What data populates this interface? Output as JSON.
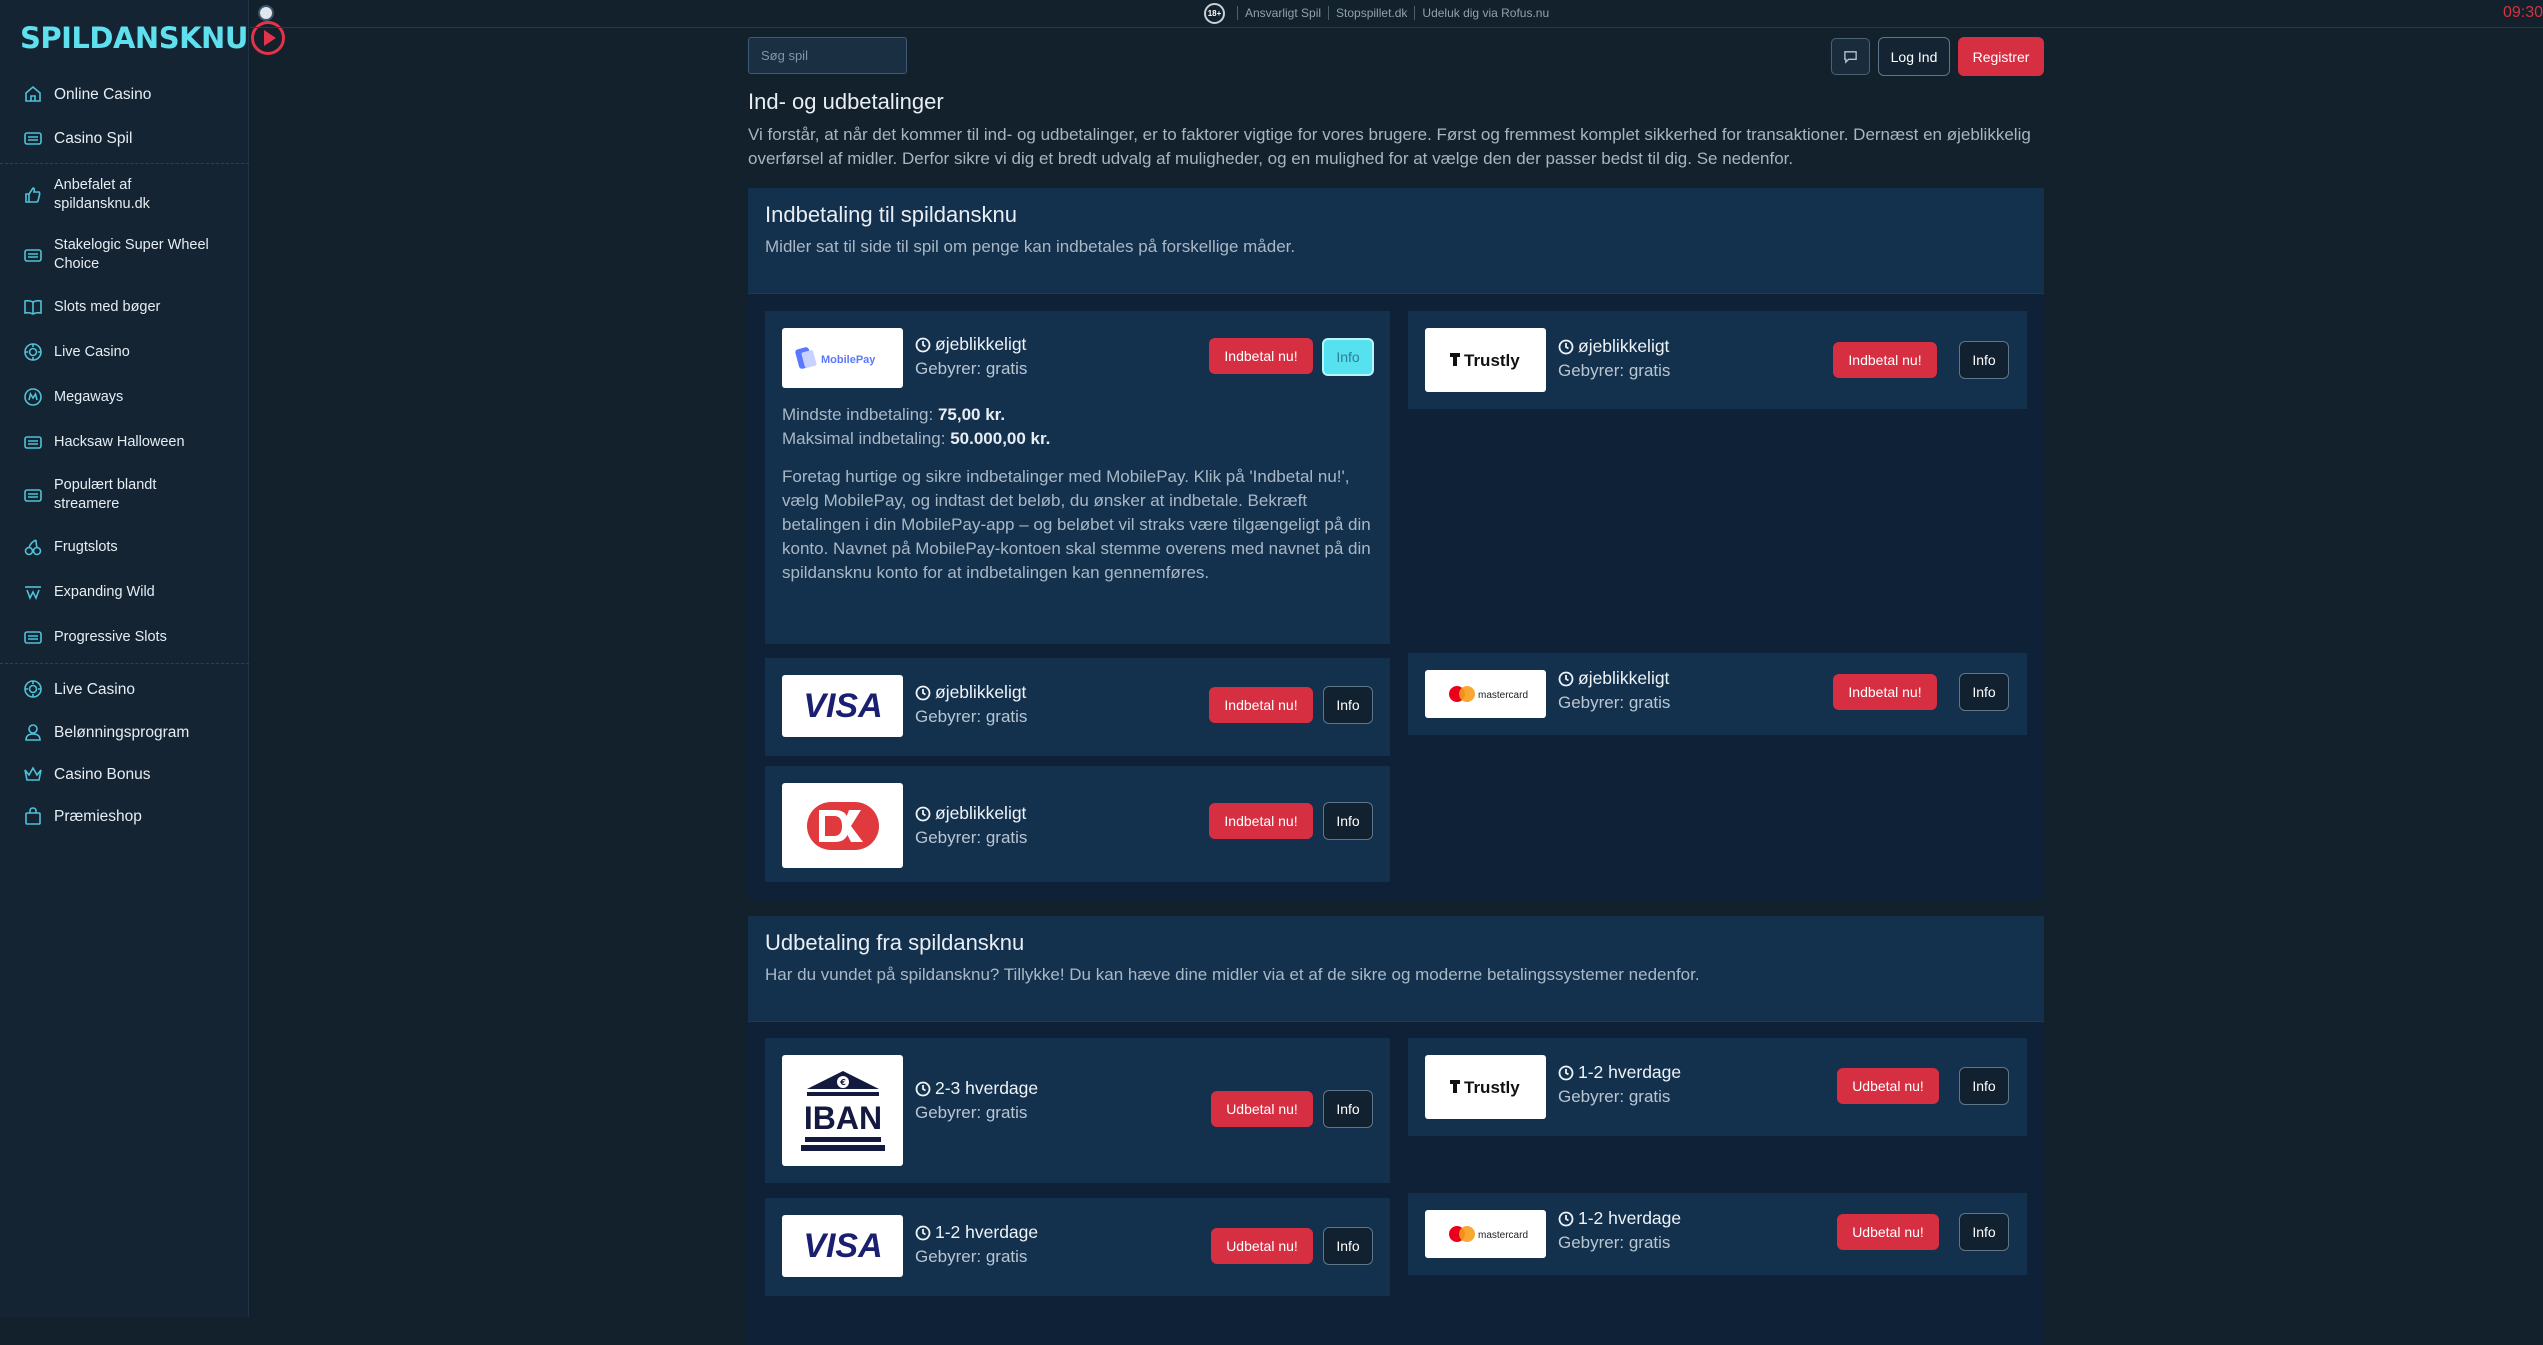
{
  "brand": {
    "name": "SPILDANSKNU"
  },
  "topbar": {
    "age_badge": "18+",
    "links": [
      "Ansvarligt Spil",
      "Stopspillet.dk",
      "Udeluk dig via Rofus.nu"
    ],
    "clock": "09:30"
  },
  "sidebar": {
    "primary": [
      {
        "label": "Online Casino",
        "icon": "home-icon"
      },
      {
        "label": "Casino Spil",
        "icon": "slot-machine-icon"
      }
    ],
    "games": [
      {
        "label": "Anbefalet af spildansknu.dk",
        "icon": "thumbs-up-icon"
      },
      {
        "label": "Stakelogic Super Wheel Choice",
        "icon": "slot-machine-icon"
      },
      {
        "label": "Slots med bøger",
        "icon": "book-icon"
      },
      {
        "label": "Live Casino",
        "icon": "poker-chip-icon"
      },
      {
        "label": "Megaways",
        "icon": "megaways-icon"
      },
      {
        "label": "Hacksaw Halloween",
        "icon": "slot-machine-icon"
      },
      {
        "label": "Populært blandt streamere",
        "icon": "slot-machine-icon"
      },
      {
        "label": "Frugtslots",
        "icon": "cherry-icon"
      },
      {
        "label": "Expanding Wild",
        "icon": "wild-icon"
      },
      {
        "label": "Progressive Slots",
        "icon": "slot-machine-icon"
      }
    ],
    "footer": [
      {
        "label": "Live Casino",
        "icon": "poker-chip-icon"
      },
      {
        "label": "Belønningsprogram",
        "icon": "user-icon"
      },
      {
        "label": "Casino Bonus",
        "icon": "crown-icon"
      },
      {
        "label": "Præmieshop",
        "icon": "shopping-bag-icon"
      }
    ]
  },
  "header": {
    "search_placeholder": "Søg spil",
    "login_label": "Log Ind",
    "register_label": "Registrer"
  },
  "page": {
    "title": "Ind- og udbetalinger",
    "intro": "Vi forstår, at når det kommer til ind- og udbetalinger, er to faktorer vigtige for vores brugere. Først og fremmest komplet sikkerhed for transaktioner. Dernæst en øjeblikkelig overførsel af midler. Derfor sikre vi dig et bredt udvalg af muligheder, og en mulighed for at vælge den der passer bedst til dig. Se nedenfor."
  },
  "deposit": {
    "title": "Indbetaling til spildansknu",
    "subtitle": "Midler sat til side til spil om penge kan indbetales på forskellige måder.",
    "action_label": "Indbetal nu!",
    "info_label": "Info",
    "methods": [
      {
        "name": "MobilePay",
        "speed": "øjeblikkeligt",
        "fee": "Gebyrer: gratis"
      },
      {
        "name": "Trustly",
        "speed": "øjeblikkeligt",
        "fee": "Gebyrer: gratis"
      },
      {
        "name": "VISA",
        "speed": "øjeblikkeligt",
        "fee": "Gebyrer: gratis"
      },
      {
        "name": "mastercard",
        "speed": "øjeblikkeligt",
        "fee": "Gebyrer: gratis"
      },
      {
        "name": "Dankort",
        "speed": "øjeblikkeligt",
        "fee": "Gebyrer: gratis"
      }
    ],
    "mobilepay_details": {
      "min_label": "Mindste indbetaling:",
      "min_value": "75,00 kr.",
      "max_label": "Maksimal indbetaling:",
      "max_value": "50.000,00 kr.",
      "description": "Foretag hurtige og sikre indbetalinger med MobilePay. Klik på 'Indbetal nu!', vælg MobilePay, og indtast det beløb, du ønsker at indbetale. Bekræft betalingen i din MobilePay-app – og beløbet vil straks være tilgængeligt på din konto. Navnet på MobilePay-kontoen skal stemme overens med navnet på din spildansknu konto for at indbetalingen kan gennemføres."
    }
  },
  "withdraw": {
    "title": "Udbetaling fra spildansknu",
    "subtitle": "Har du vundet på spildansknu? Tillykke! Du kan hæve dine midler via et af de sikre og moderne betalingssystemer nedenfor.",
    "action_label": "Udbetal nu!",
    "info_label": "Info",
    "methods": [
      {
        "name": "IBAN",
        "speed": "2-3 hverdage",
        "fee": "Gebyrer: gratis"
      },
      {
        "name": "Trustly",
        "speed": "1-2 hverdage",
        "fee": "Gebyrer: gratis"
      },
      {
        "name": "VISA",
        "speed": "1-2 hverdage",
        "fee": "Gebyrer: gratis"
      },
      {
        "name": "mastercard",
        "speed": "1-2 hverdage",
        "fee": "Gebyrer: gratis"
      }
    ]
  },
  "colors": {
    "accent_red": "#d72f42",
    "accent_cyan": "#5ee0ee",
    "background": "#12212c"
  }
}
